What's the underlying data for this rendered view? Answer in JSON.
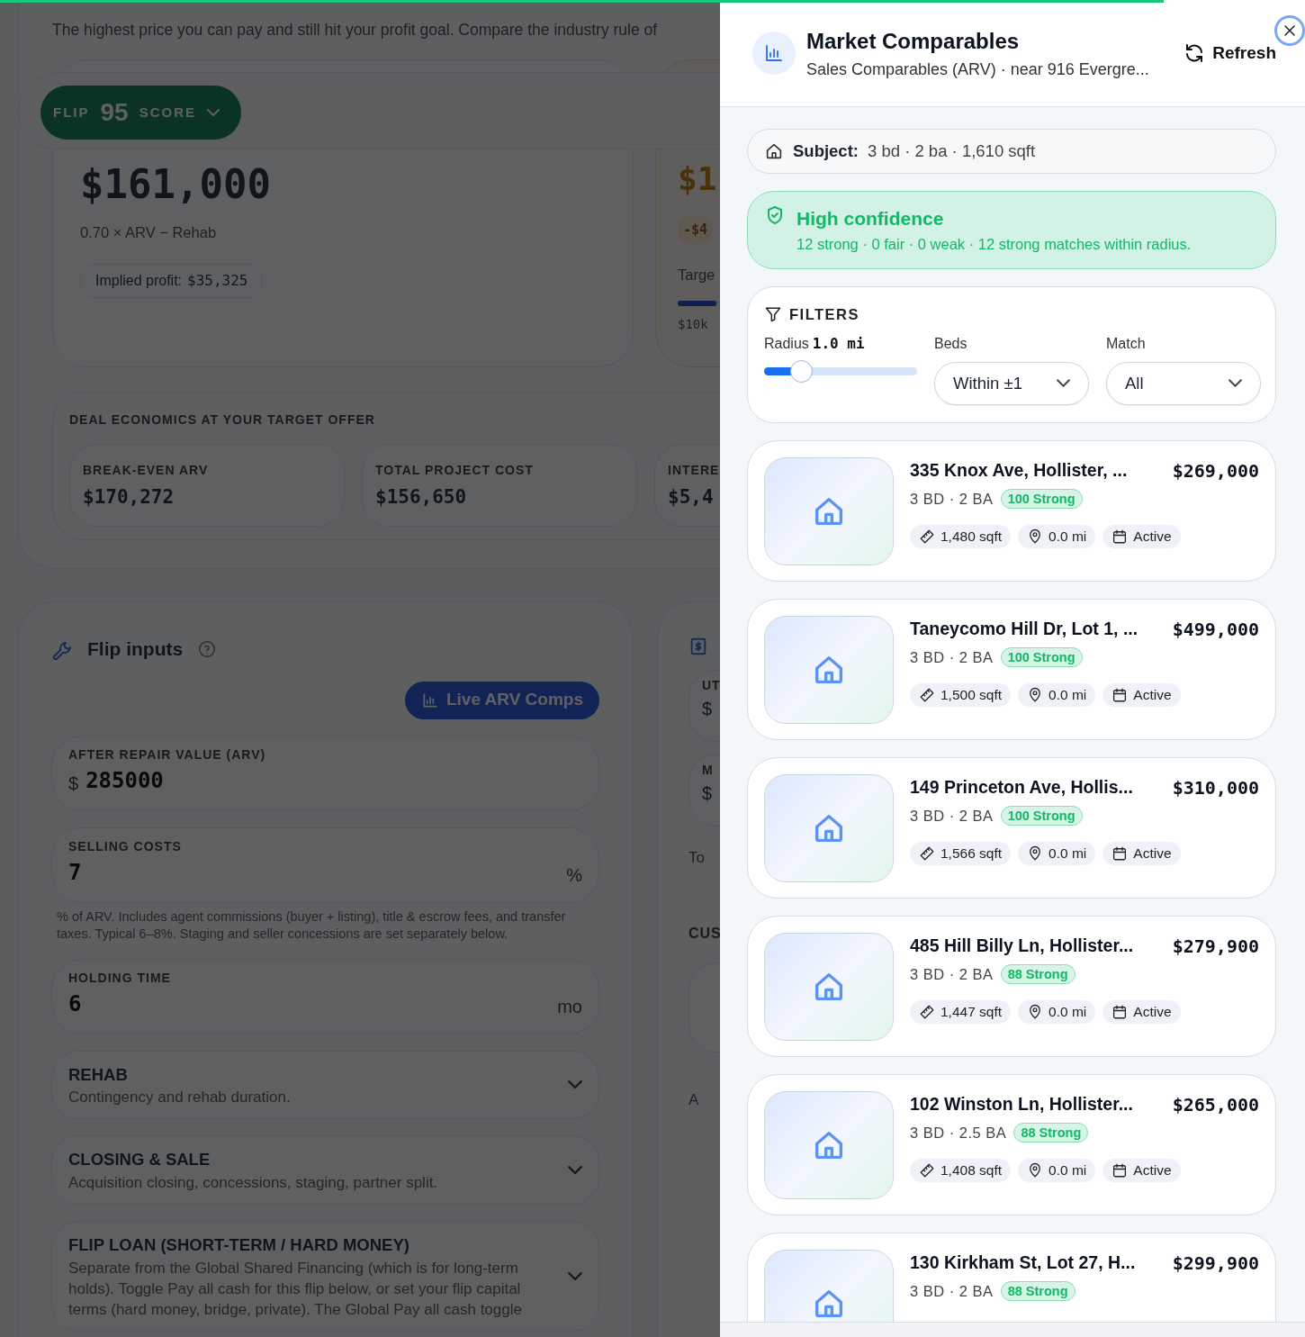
{
  "page_progress": {
    "level": 0.892
  },
  "mao_section": {
    "description": "The highest price you can pay and still hit your profit goal. Compare the industry rule of",
    "score_pill": {
      "label": "FLIP",
      "score": "95",
      "suffix": "SCORE"
    },
    "mao_card": {
      "value": "$161,000",
      "formula": "0.70 × ARV − Rehab",
      "profit_label": "Implied profit:",
      "profit_value": "$35,325"
    },
    "target_card": {
      "value": "$1",
      "delta": "-$4",
      "label": "Targe",
      "level": 0.16,
      "tick": "$10k"
    },
    "deal_economics": {
      "title": "DEAL ECONOMICS AT YOUR TARGET OFFER",
      "stats": [
        {
          "label": "BREAK-EVEN ARV",
          "value": "$170,272"
        },
        {
          "label": "TOTAL PROJECT COST",
          "value": "$156,650"
        },
        {
          "label": "INTERE",
          "value": "$5,4"
        }
      ]
    }
  },
  "flip_inputs": {
    "title": "Flip inputs",
    "comps_button": "Live ARV Comps",
    "fields": [
      {
        "label": "AFTER REPAIR VALUE (ARV)",
        "prefix": "$",
        "value": "285000"
      },
      {
        "label": "SELLING COSTS",
        "value": "7",
        "suffix": "%",
        "help": "% of ARV. Includes agent commissions (buyer + listing), title & escrow fees, and transfer taxes. Typical 6–8%. Staging and seller concessions are set separately below."
      },
      {
        "label": "HOLDING TIME",
        "value": "6",
        "suffix": "mo"
      }
    ],
    "sections": [
      {
        "title": "REHAB",
        "description": "Contingency and rehab duration.",
        "expanded": false
      },
      {
        "title": "CLOSING & SALE",
        "description": "Acquisition closing, concessions, staging, partner split.",
        "expanded": false
      },
      {
        "title": "FLIP LOAN (SHORT-TERM / HARD MONEY)",
        "description": "Separate from the Global Shared Financing (which is for long-term holds). Toggle Pay all cash for this flip below, or set your flip capital terms (hard money, bridge, private). The Global Pay all cash toggle",
        "expanded": false
      }
    ]
  },
  "side_card": {
    "fields": [
      {
        "label": "UT",
        "value": "$"
      },
      {
        "label": "M",
        "value": "$"
      }
    ],
    "total": "To",
    "heading": "CUS",
    "item": "A"
  },
  "drawer": {
    "title": "Market Comparables",
    "subtitle": "Sales Comparables (ARV) · near 916 Evergre...",
    "refresh": "Refresh",
    "subject": {
      "label": "Subject:",
      "value": "3 bd · 2 ba · 1,610 sqft"
    },
    "confidence": {
      "title": "High confidence",
      "detail": "12 strong · 0 fair · 0 weak · 12 strong matches within radius."
    },
    "filters": {
      "title": "FILTERS",
      "radius": {
        "label": "Radius",
        "value": "1.0 mi",
        "level": 0.24
      },
      "beds": {
        "label": "Beds",
        "value": "Within ±1"
      },
      "match": {
        "label": "Match",
        "value": "All"
      }
    },
    "comps": [
      {
        "address": "335 Knox Ave, Hollister, ...",
        "price": "$269,000",
        "beds_baths": "3 BD · 2 BA",
        "score": "100 Strong",
        "sqft": "1,480 sqft",
        "distance": "0.0 mi",
        "status": "Active"
      },
      {
        "address": "Taneycomo Hill Dr, Lot 1, ...",
        "price": "$499,000",
        "beds_baths": "3 BD · 2 BA",
        "score": "100 Strong",
        "sqft": "1,500 sqft",
        "distance": "0.0 mi",
        "status": "Active"
      },
      {
        "address": "149 Princeton Ave, Hollis...",
        "price": "$310,000",
        "beds_baths": "3 BD · 2 BA",
        "score": "100 Strong",
        "sqft": "1,566 sqft",
        "distance": "0.0 mi",
        "status": "Active"
      },
      {
        "address": "485 Hill Billy Ln, Hollister...",
        "price": "$279,900",
        "beds_baths": "3 BD · 2 BA",
        "score": "88 Strong",
        "sqft": "1,447 sqft",
        "distance": "0.0 mi",
        "status": "Active"
      },
      {
        "address": "102 Winston Ln, Hollister...",
        "price": "$265,000",
        "beds_baths": "3 BD · 2.5 BA",
        "score": "88 Strong",
        "sqft": "1,408 sqft",
        "distance": "0.0 mi",
        "status": "Active"
      },
      {
        "address": "130 Kirkham St, Lot 27, H...",
        "price": "$299,900",
        "beds_baths": "3 BD · 2 BA",
        "score": "88 Strong"
      }
    ]
  }
}
